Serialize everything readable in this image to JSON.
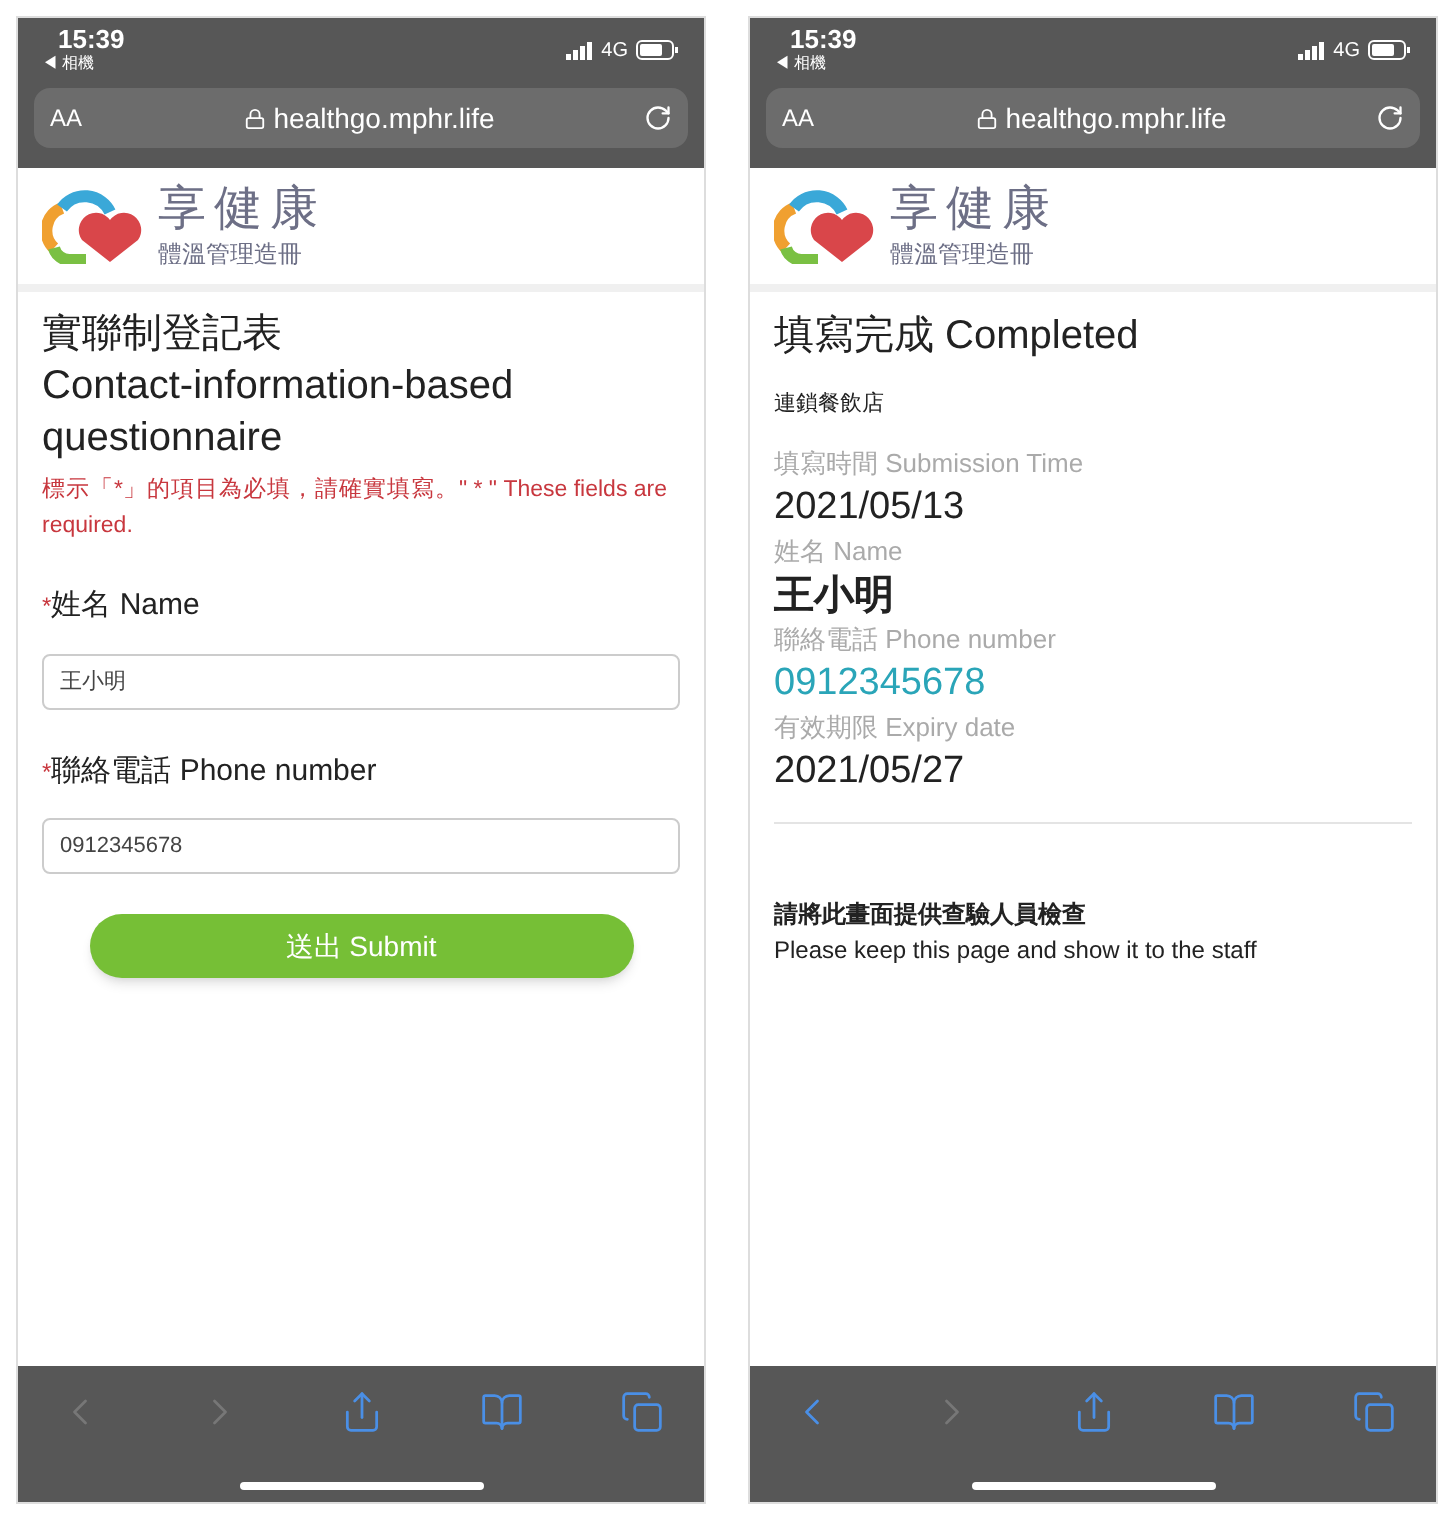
{
  "phones": [
    {
      "kind": "form",
      "status": {
        "time": "15:39",
        "back_app": "◀ 相機",
        "network": "4G"
      },
      "address_bar": {
        "text_size": "AA",
        "url": "healthgo.mphr.life"
      },
      "logo": {
        "title": "享健康",
        "subtitle": "體溫管理造冊"
      },
      "form": {
        "title_zh": "實聯制登記表",
        "title_en": "Contact-information-based questionnaire",
        "notice": "標示「*」的項目為必填，請確實填寫。\" * \" These fields are required.",
        "fields": [
          {
            "required_mark": "*",
            "label": "姓名 Name",
            "value": "王小明"
          },
          {
            "required_mark": "*",
            "label": "聯絡電話 Phone number",
            "value": "0912345678"
          }
        ],
        "submit": "送出 Submit"
      },
      "toolbar": [
        {
          "kind": "back",
          "disabled": true
        },
        {
          "kind": "forward",
          "disabled": true
        },
        {
          "kind": "share",
          "disabled": false
        },
        {
          "kind": "bookmarks",
          "disabled": false
        },
        {
          "kind": "tabs",
          "disabled": false
        }
      ]
    },
    {
      "kind": "result",
      "status": {
        "time": "15:39",
        "back_app": "◀ 相機",
        "network": "4G"
      },
      "address_bar": {
        "text_size": "AA",
        "url": "healthgo.mphr.life"
      },
      "logo": {
        "title": "享健康",
        "subtitle": "體溫管理造冊"
      },
      "result": {
        "title": "填寫完成 Completed",
        "store": "連鎖餐飲店",
        "items": [
          {
            "kind": "date",
            "label": "填寫時間 Submission Time",
            "value": "2021/05/13"
          },
          {
            "kind": "name",
            "label": "姓名 Name",
            "value": "王小明"
          },
          {
            "kind": "phone",
            "label": "聯絡電話 Phone number",
            "value": "0912345678"
          },
          {
            "kind": "date",
            "label": "有效期限 Expiry date",
            "value": "2021/05/27"
          }
        ],
        "note_zh": "請將此畫面提供查驗人員檢查",
        "note_en": "Please keep this page and show it to the staff"
      },
      "toolbar": [
        {
          "kind": "back",
          "disabled": false
        },
        {
          "kind": "forward",
          "disabled": true
        },
        {
          "kind": "share",
          "disabled": false
        },
        {
          "kind": "bookmarks",
          "disabled": false
        },
        {
          "kind": "tabs",
          "disabled": false
        }
      ]
    }
  ]
}
